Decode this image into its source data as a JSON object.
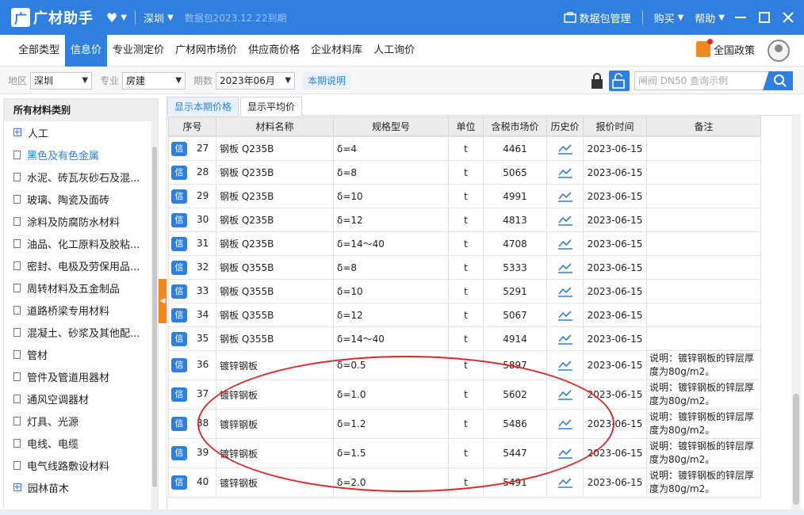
{
  "titlebar": {
    "logo_letter": "广",
    "app_name": "广材助手",
    "city": "深圳",
    "expire_notice": "数据包2023.12.22到期",
    "manage": "数据包管理",
    "buy": "购买",
    "help": "帮助"
  },
  "nav": {
    "tabs": [
      "全部类型",
      "信息价",
      "专业测定价",
      "广材网市场价",
      "供应商价格",
      "企业材料库",
      "人工询价"
    ],
    "active_tab": "信息价",
    "policy": "全国政策"
  },
  "filter": {
    "region_label": "地区",
    "region_value": "深圳",
    "major_label": "专业",
    "major_value": "房建",
    "period_label": "期数",
    "period_value": "2023年06月",
    "explain": "本期说明",
    "search_placeholder": "闸阀 DN50 查询示例"
  },
  "sidebar": {
    "header": "所有材料类别",
    "items": [
      {
        "label": "人工",
        "type": "plus",
        "active": false
      },
      {
        "label": "黑色及有色金属",
        "type": "doc",
        "active": true
      },
      {
        "label": "水泥、砖瓦灰砂石及混...",
        "type": "doc",
        "active": false
      },
      {
        "label": "玻璃、陶瓷及面砖",
        "type": "doc",
        "active": false
      },
      {
        "label": "涂料及防腐防水材料",
        "type": "doc",
        "active": false
      },
      {
        "label": "油品、化工原料及胶粘...",
        "type": "doc",
        "active": false
      },
      {
        "label": "密封、电极及劳保用品...",
        "type": "doc",
        "active": false
      },
      {
        "label": "周转材料及五金制品",
        "type": "doc",
        "active": false
      },
      {
        "label": "道路桥梁专用材料",
        "type": "doc",
        "active": false
      },
      {
        "label": "混凝土、砂浆及其他配...",
        "type": "doc",
        "active": false
      },
      {
        "label": "管材",
        "type": "doc",
        "active": false
      },
      {
        "label": "管件及管道用器材",
        "type": "doc",
        "active": false
      },
      {
        "label": "通风空调器材",
        "type": "doc",
        "active": false
      },
      {
        "label": "灯具、光源",
        "type": "doc",
        "active": false
      },
      {
        "label": "电线、电缆",
        "type": "doc",
        "active": false
      },
      {
        "label": "电气线路敷设材料",
        "type": "doc",
        "active": false
      },
      {
        "label": "园林苗木",
        "type": "plus",
        "active": false
      }
    ]
  },
  "subtabs": [
    "显示本期价格",
    "显示平均价"
  ],
  "table": {
    "headers": [
      "序号",
      "材料名称",
      "规格型号",
      "单位",
      "含税市场价",
      "历史价",
      "报价时间",
      "备注"
    ],
    "badge": "信",
    "rows": [
      {
        "no": "27",
        "name": "钢板 Q235B",
        "spec": "δ=4",
        "unit": "t",
        "price": "4461",
        "date": "2023-06-15",
        "note": ""
      },
      {
        "no": "28",
        "name": "钢板 Q235B",
        "spec": "δ=8",
        "unit": "t",
        "price": "5065",
        "date": "2023-06-15",
        "note": ""
      },
      {
        "no": "29",
        "name": "钢板 Q235B",
        "spec": "δ=10",
        "unit": "t",
        "price": "4991",
        "date": "2023-06-15",
        "note": ""
      },
      {
        "no": "30",
        "name": "钢板 Q235B",
        "spec": "δ=12",
        "unit": "t",
        "price": "4813",
        "date": "2023-06-15",
        "note": ""
      },
      {
        "no": "31",
        "name": "钢板 Q235B",
        "spec": "δ=14～40",
        "unit": "t",
        "price": "4708",
        "date": "2023-06-15",
        "note": ""
      },
      {
        "no": "32",
        "name": "钢板 Q355B",
        "spec": "δ=8",
        "unit": "t",
        "price": "5333",
        "date": "2023-06-15",
        "note": ""
      },
      {
        "no": "33",
        "name": "钢板 Q355B",
        "spec": "δ=10",
        "unit": "t",
        "price": "5291",
        "date": "2023-06-15",
        "note": ""
      },
      {
        "no": "34",
        "name": "钢板 Q355B",
        "spec": "δ=12",
        "unit": "t",
        "price": "5067",
        "date": "2023-06-15",
        "note": ""
      },
      {
        "no": "35",
        "name": "钢板 Q355B",
        "spec": "δ=14～40",
        "unit": "t",
        "price": "4914",
        "date": "2023-06-15",
        "note": ""
      },
      {
        "no": "36",
        "name": "镀锌钢板",
        "spec": "δ=0.5",
        "unit": "t",
        "price": "5897",
        "date": "2023-06-15",
        "note": "说明：镀锌钢板的锌层厚度为80g/m2。"
      },
      {
        "no": "37",
        "name": "镀锌钢板",
        "spec": "δ=1.0",
        "unit": "t",
        "price": "5602",
        "date": "2023-06-15",
        "note": "说明：镀锌钢板的锌层厚度为80g/m2。"
      },
      {
        "no": "38",
        "name": "镀锌钢板",
        "spec": "δ=1.2",
        "unit": "t",
        "price": "5486",
        "date": "2023-06-15",
        "note": "说明：镀锌钢板的锌层厚度为80g/m2。"
      },
      {
        "no": "39",
        "name": "镀锌钢板",
        "spec": "δ=1.5",
        "unit": "t",
        "price": "5447",
        "date": "2023-06-15",
        "note": "说明：镀锌钢板的锌层厚度为80g/m2。"
      },
      {
        "no": "40",
        "name": "镀锌钢板",
        "spec": "δ=2.0",
        "unit": "t",
        "price": "5491",
        "date": "2023-06-15",
        "note": "说明：镀锌钢板的锌层厚度为80g/m2。"
      }
    ]
  },
  "colors": {
    "accent": "#2f7fe0",
    "orange": "#f0891e",
    "highlight": "#e0262a"
  }
}
